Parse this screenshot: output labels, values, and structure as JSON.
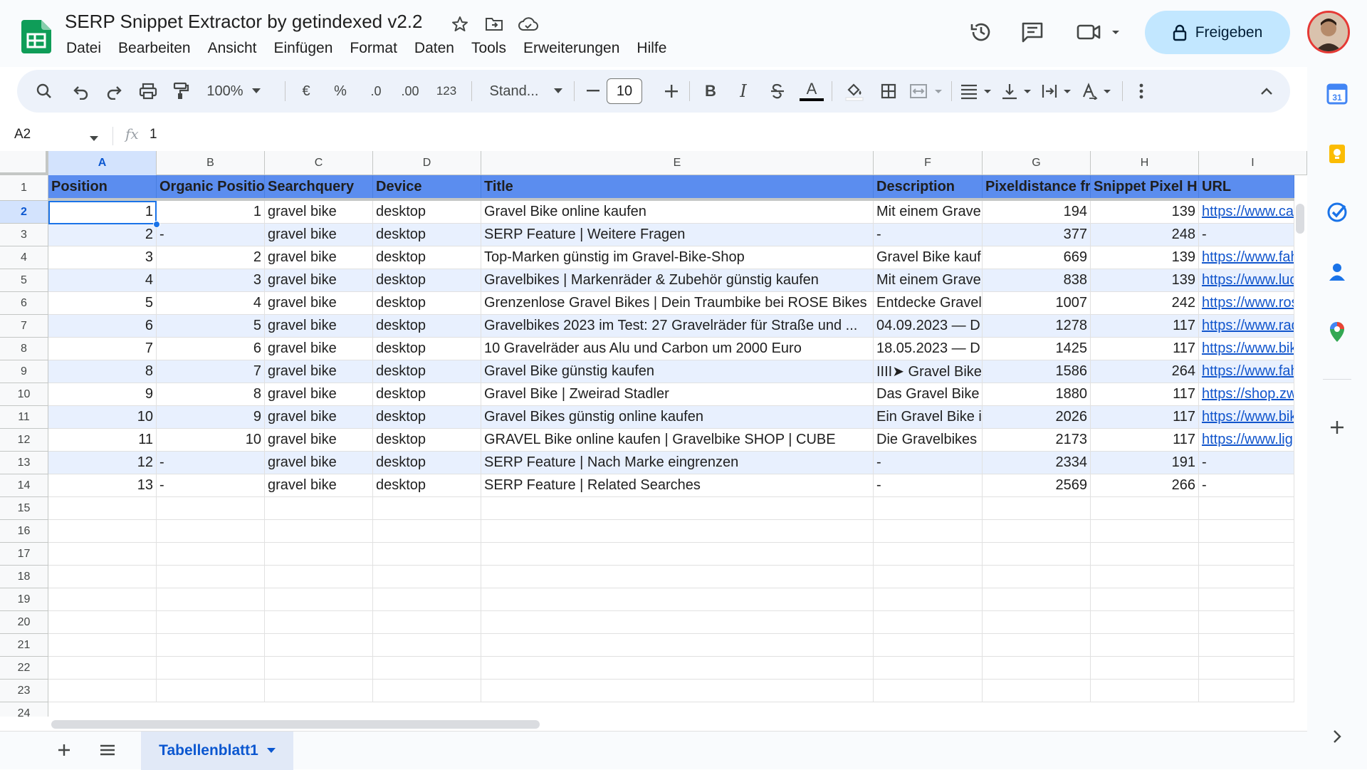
{
  "app": {
    "doc_title": "SERP Snippet Extractor by getindexed v2.2",
    "share_label": "Freigeben"
  },
  "menu": [
    "Datei",
    "Bearbeiten",
    "Ansicht",
    "Einfügen",
    "Format",
    "Daten",
    "Tools",
    "Erweiterungen",
    "Hilfe"
  ],
  "toolbar": {
    "zoom": "100%",
    "currency": "€",
    "percent": "%",
    "dec_decrease": ".0",
    "dec_increase": ".00",
    "number_format": "123",
    "font": "Stand...",
    "font_size": "10",
    "bold": "B",
    "italic": "I",
    "text_color": "A"
  },
  "formula_bar": {
    "name_box": "A2",
    "fx": "fx",
    "value": "1"
  },
  "columns": [
    "A",
    "B",
    "C",
    "D",
    "E",
    "F",
    "G",
    "H",
    "I"
  ],
  "row_numbers": [
    "1",
    "2",
    "3",
    "4",
    "5",
    "6",
    "7",
    "8",
    "9",
    "10",
    "11",
    "12",
    "13",
    "14",
    "15",
    "16",
    "17",
    "18",
    "19",
    "20",
    "21",
    "22",
    "23",
    "24"
  ],
  "header_row": [
    "Position",
    "Organic Positio",
    "Searchquery",
    "Device",
    "Title",
    "Description",
    "Pixeldistance fr",
    "Snippet Pixel H",
    "URL"
  ],
  "rows": [
    [
      "1",
      "1",
      "gravel bike",
      "desktop",
      "Gravel Bike online kaufen",
      "Mit einem Grave",
      "194",
      "139",
      "https://www.ca"
    ],
    [
      "2",
      "-",
      "gravel bike",
      "desktop",
      "SERP Feature | Weitere Fragen",
      "-",
      "377",
      "248",
      "-"
    ],
    [
      "3",
      "2",
      "gravel bike",
      "desktop",
      "Top-Marken günstig im Gravel-Bike-Shop",
      "Gravel Bike kauf",
      "669",
      "139",
      "https://www.fah"
    ],
    [
      "4",
      "3",
      "gravel bike",
      "desktop",
      "Gravelbikes | Markenräder & Zubehör günstig kaufen",
      "Mit einem Grave",
      "838",
      "139",
      "https://www.luc"
    ],
    [
      "5",
      "4",
      "gravel bike",
      "desktop",
      "Grenzenlose Gravel Bikes | Dein Traumbike bei ROSE Bikes",
      "Entdecke Gravel",
      "1007",
      "242",
      "https://www.ros"
    ],
    [
      "6",
      "5",
      "gravel bike",
      "desktop",
      "Gravelbikes 2023 im Test: 27 Gravelräder für Straße und ...",
      "04.09.2023 — D",
      "1278",
      "117",
      "https://www.rad"
    ],
    [
      "7",
      "6",
      "gravel bike",
      "desktop",
      "10 Gravelräder aus Alu und Carbon um 2000 Euro",
      "18.05.2023 — D",
      "1425",
      "117",
      "https://www.bik"
    ],
    [
      "8",
      "7",
      "gravel bike",
      "desktop",
      "Gravel Bike günstig kaufen",
      "IIII➤ Gravel Bike",
      "1586",
      "264",
      "https://www.fah"
    ],
    [
      "9",
      "8",
      "gravel bike",
      "desktop",
      "Gravel Bike | Zweirad Stadler",
      "Das Gravel Bike",
      "1880",
      "117",
      "https://shop.zw"
    ],
    [
      "10",
      "9",
      "gravel bike",
      "desktop",
      "Gravel Bikes günstig online kaufen",
      "Ein Gravel Bike i",
      "2026",
      "117",
      "https://www.bik"
    ],
    [
      "11",
      "10",
      "gravel bike",
      "desktop",
      "GRAVEL Bike online kaufen | Gravelbike SHOP | CUBE",
      "Die Gravelbikes",
      "2173",
      "117",
      "https://www.lig"
    ],
    [
      "12",
      "-",
      "gravel bike",
      "desktop",
      "SERP Feature | Nach Marke eingrenzen",
      "-",
      "2334",
      "191",
      "-"
    ],
    [
      "13",
      "-",
      "gravel bike",
      "desktop",
      "SERP Feature | Related Searches",
      "-",
      "2569",
      "266",
      "-"
    ]
  ],
  "sheet_tab": "Tabellenblatt1",
  "colors": {
    "header_fill": "#5b8def",
    "band_fill": "#e8f0fe",
    "selection": "#1a73e8",
    "share_bg": "#c2e7ff"
  }
}
